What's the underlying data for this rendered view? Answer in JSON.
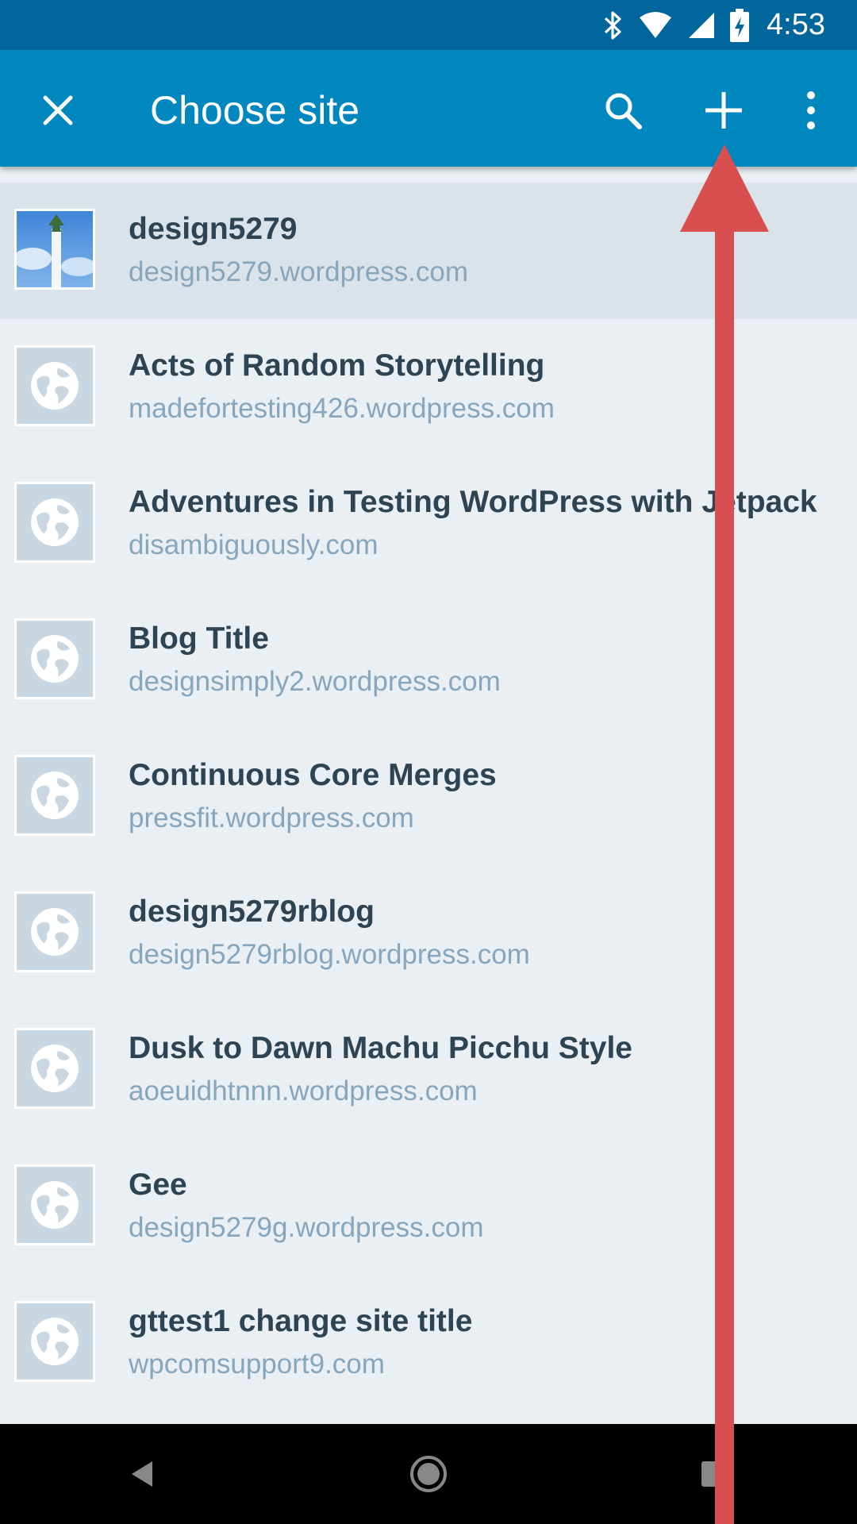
{
  "status_bar": {
    "time": "4:53",
    "icons": [
      "bluetooth-icon",
      "wifi-icon",
      "signal-icon",
      "battery-charging-icon"
    ]
  },
  "app_bar": {
    "title": "Choose site",
    "close_icon": "close-icon",
    "actions": [
      "search-icon",
      "add-icon",
      "more-vert-icon"
    ]
  },
  "sites": [
    {
      "name": "design5279",
      "url": "design5279.wordpress.com",
      "icon": "site-image",
      "selected": true
    },
    {
      "name": "Acts of Random Storytelling",
      "url": "madefortesting426.wordpress.com",
      "icon": "globe-icon"
    },
    {
      "name": "Adventures in Testing WordPress with Jetpack",
      "url": "disambiguously.com",
      "icon": "globe-icon"
    },
    {
      "name": "Blog Title",
      "url": "designsimply2.wordpress.com",
      "icon": "globe-icon"
    },
    {
      "name": "Continuous Core Merges",
      "url": "pressfit.wordpress.com",
      "icon": "globe-icon"
    },
    {
      "name": "design5279rblog",
      "url": "design5279rblog.wordpress.com",
      "icon": "globe-icon"
    },
    {
      "name": "Dusk to Dawn Machu Picchu Style",
      "url": "aoeuidhtnnn.wordpress.com",
      "icon": "globe-icon"
    },
    {
      "name": "Gee",
      "url": "design5279g.wordpress.com",
      "icon": "globe-icon"
    },
    {
      "name": "gttest1 change site title",
      "url": "wpcomsupport9.com",
      "icon": "globe-icon"
    }
  ],
  "nav_bar": {
    "buttons": [
      "back-icon",
      "home-icon",
      "recents-icon"
    ]
  },
  "colors": {
    "primary": "#0087be",
    "status": "#00669b",
    "background": "#e9eff3",
    "selected_row": "#dbe3ea",
    "annotation_arrow": "#d94f4f"
  }
}
